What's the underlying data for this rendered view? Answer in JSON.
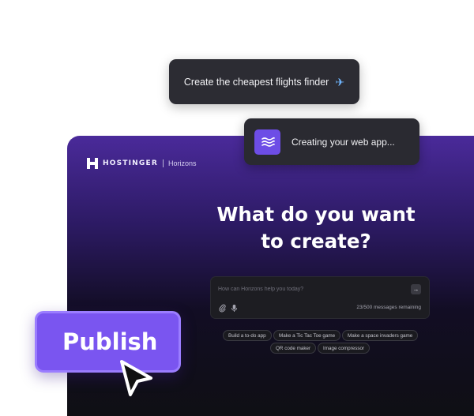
{
  "bubbles": {
    "request": {
      "text": "Create the cheapest flights finder",
      "icon": "airplane-icon"
    },
    "status": {
      "text": "Creating your web app...",
      "icon": "waves-icon"
    }
  },
  "brand": {
    "name": "HOSTINGER",
    "product": "Horizons"
  },
  "headline": "What do you want to create?",
  "prompt": {
    "placeholder": "How can Horizons help you today?",
    "value": "",
    "remaining": "23/500 messages remaining"
  },
  "suggestions": [
    "Build a to-do app",
    "Make a Tic Tac Toe game",
    "Make a space invaders game",
    "QR code maker",
    "Image compressor"
  ],
  "publish": {
    "label": "Publish"
  },
  "colors": {
    "accent": "#7a55f0",
    "panel_top": "#4a2a9a",
    "panel_bottom": "#0f0f14",
    "bubble_bg": "#2c2c33"
  }
}
